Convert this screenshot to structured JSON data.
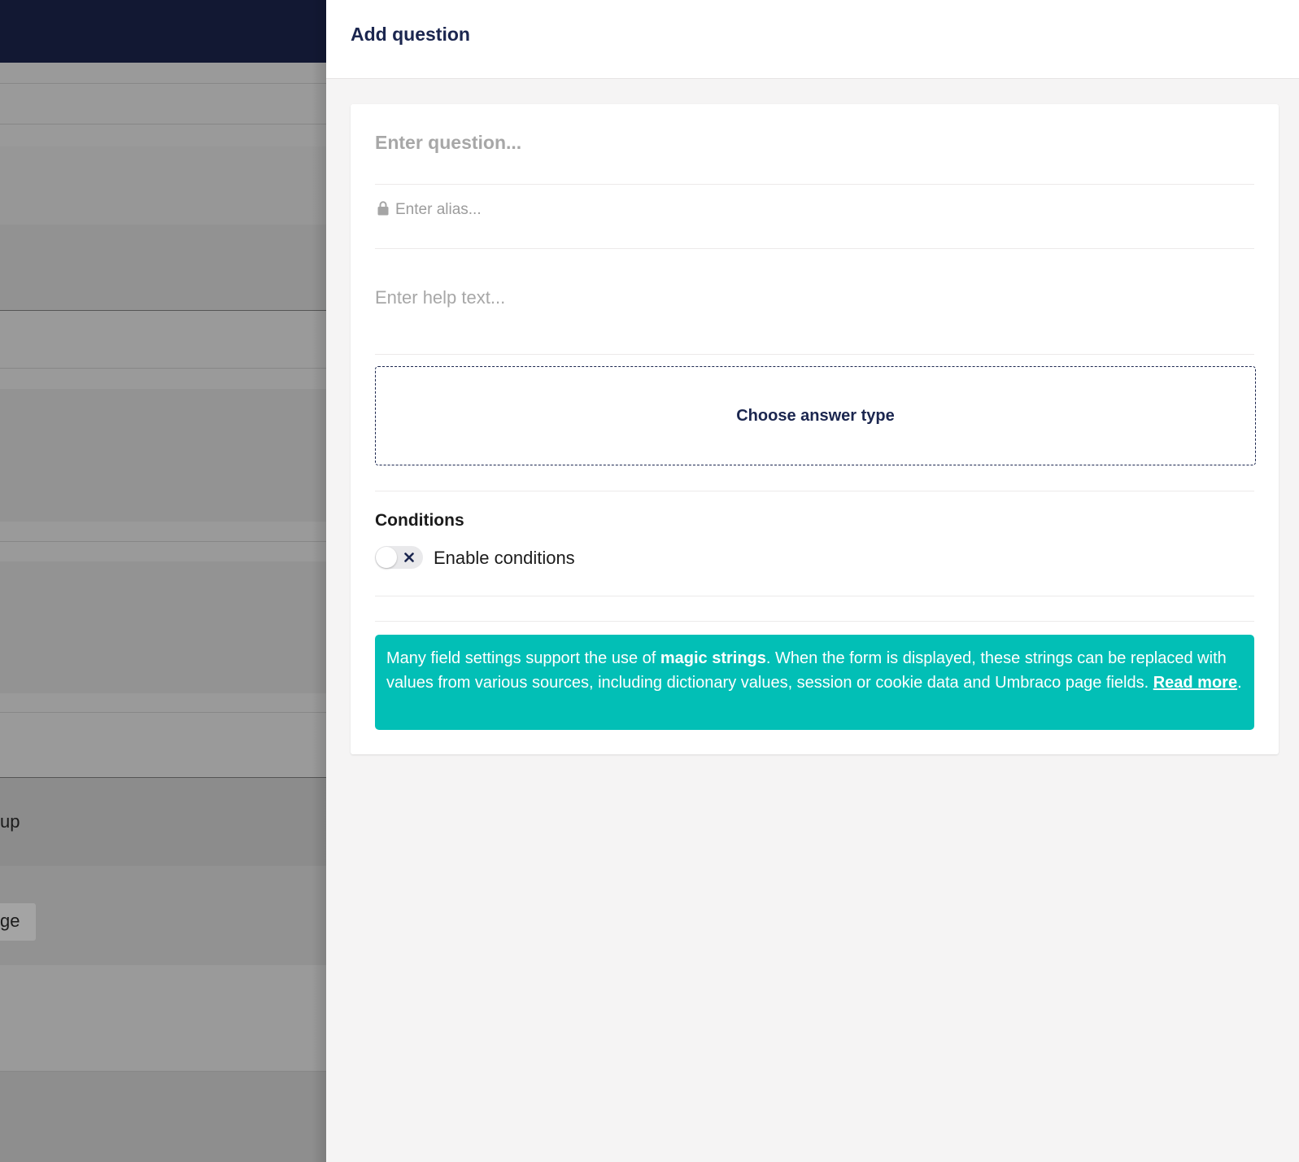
{
  "background": {
    "fragment_group": "up",
    "fragment_button": "ge"
  },
  "panel": {
    "title": "Add question",
    "question_placeholder": "Enter question...",
    "alias_placeholder": "Enter alias...",
    "help_placeholder": "Enter help text...",
    "answer_type_label": "Choose answer type",
    "conditions": {
      "title": "Conditions",
      "toggle_label": "Enable conditions",
      "enabled": false
    },
    "info": {
      "text_before": "Many field settings support the use of ",
      "bold": "magic strings",
      "text_after": ". When the form is displayed, these strings can be replaced with values from various sources, including dictionary values, session or cookie data and Umbraco page fields. ",
      "link": "Read more",
      "end": "."
    }
  },
  "colors": {
    "header_dark": "#121833",
    "accent_navy": "#1b264f",
    "info_teal": "#02bfb6"
  },
  "icons": {
    "alias_lock": "lock-icon",
    "toggle_off": "close-icon"
  }
}
